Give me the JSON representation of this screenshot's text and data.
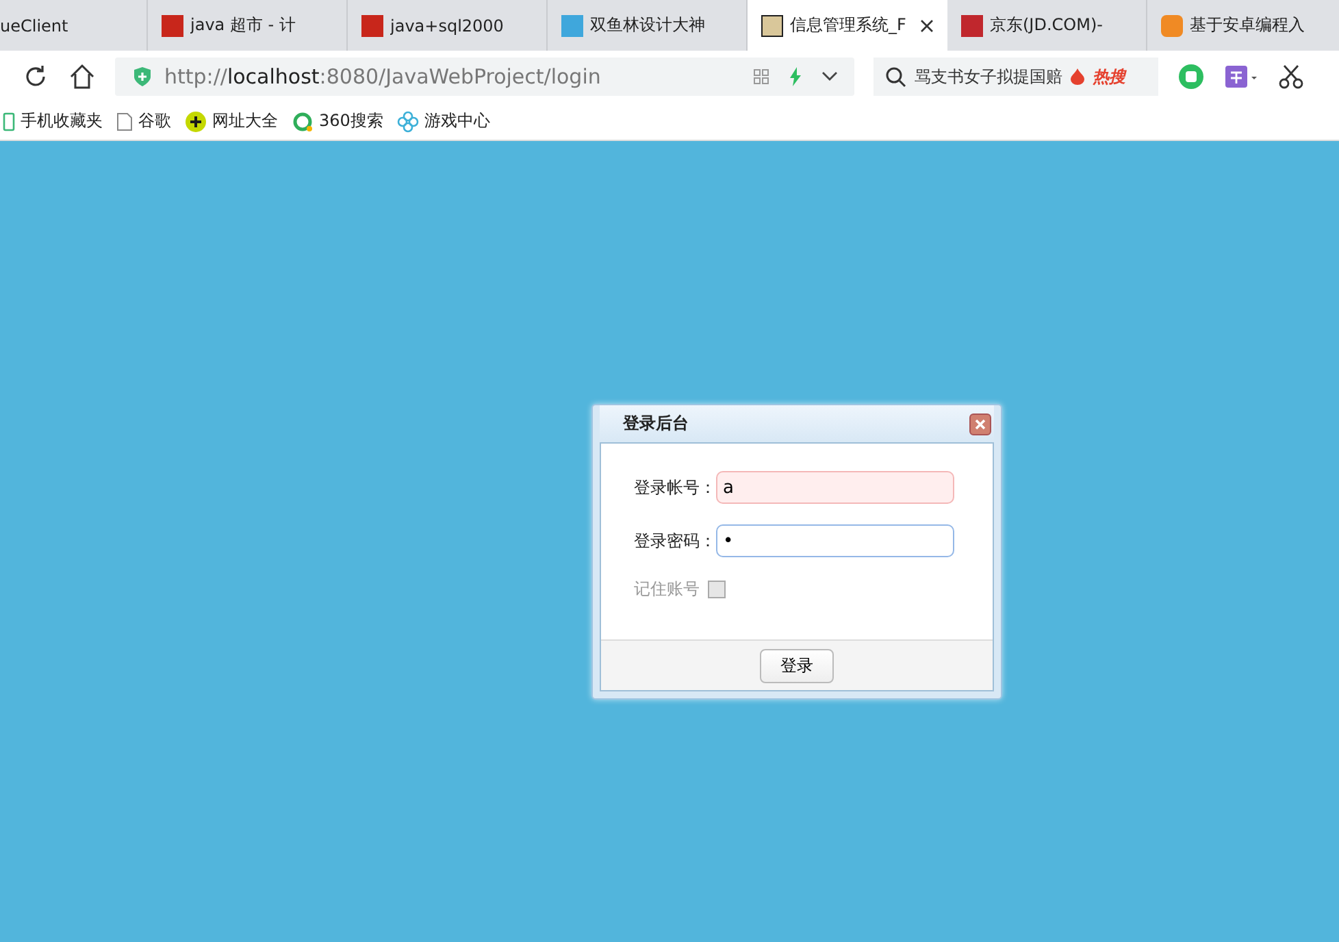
{
  "tabs": [
    {
      "label": "ueClient",
      "selected": false
    },
    {
      "label": "java 超市 - 计",
      "selected": false
    },
    {
      "label": "java+sql2000",
      "selected": false
    },
    {
      "label": "双鱼林设计大神",
      "selected": false
    },
    {
      "label": "信息管理系统_F",
      "selected": true
    },
    {
      "label": "京东(JD.COM)-",
      "selected": false
    },
    {
      "label": "基于安卓编程入",
      "selected": false
    }
  ],
  "address": {
    "url": "http://**localhost**:8080/JavaWebProject/login"
  },
  "search": {
    "value": "骂支书女子拟提国赔",
    "hot": "热搜"
  },
  "bookmarks": [
    {
      "label": "手机收藏夹"
    },
    {
      "label": "谷歌"
    },
    {
      "label": "网址大全"
    },
    {
      "label": "360搜索"
    },
    {
      "label": "游戏中心"
    }
  ],
  "dialog": {
    "title": "登录后台",
    "fields": [
      {
        "label": "登录帐号：",
        "value": "a",
        "invalid": true
      },
      {
        "label": "登录密码：",
        "value": "•",
        "invalid": false
      }
    ],
    "remember": {
      "label": "记住账号",
      "checked": false
    },
    "button": "登录"
  }
}
